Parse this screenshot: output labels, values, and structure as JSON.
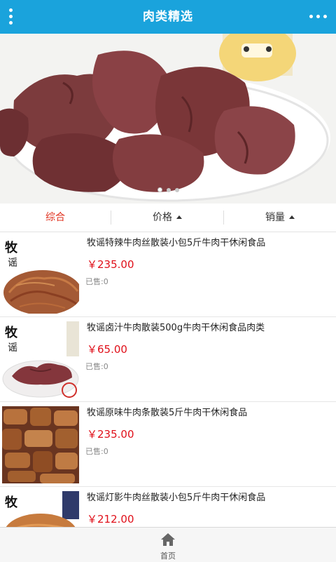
{
  "header": {
    "title": "肉类精选",
    "menu_icon": "vertical-dots-icon",
    "more_icon": "horizontal-dots-icon",
    "background": "#1aa3dc"
  },
  "banner": {
    "slides": 3,
    "active_slide": 1
  },
  "sort": [
    {
      "label": "综合",
      "active": true
    },
    {
      "label": "价格",
      "active": false,
      "arrow": "up"
    },
    {
      "label": "销量",
      "active": false,
      "arrow": "up"
    }
  ],
  "products": [
    {
      "name": "牧谣特辣牛肉丝散装小包5斤牛肉干休闲食品",
      "price": "￥235.00",
      "sold": "已售:0"
    },
    {
      "name": "牧谣卤汁牛肉散装500g牛肉干休闲食品肉类",
      "price": "￥65.00",
      "sold": "已售:0"
    },
    {
      "name": "牧谣原味牛肉条散装5斤牛肉干休闲食品",
      "price": "￥235.00",
      "sold": "已售:0"
    },
    {
      "name": "牧谣灯影牛肉丝散装小包5斤牛肉干休闲食品",
      "price": "￥212.00",
      "sold": ""
    }
  ],
  "tabbar": {
    "home_label": "首页",
    "home_icon": "home-icon"
  },
  "colors": {
    "accent": "#1aa3dc",
    "price": "#e0101a",
    "active_sort": "#e0301e"
  }
}
